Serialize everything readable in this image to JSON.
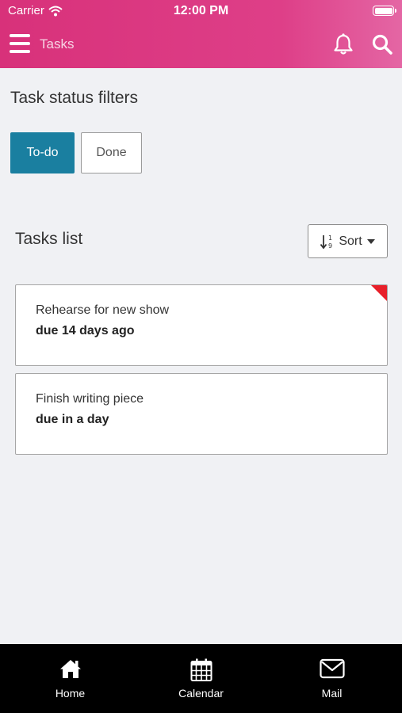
{
  "status_bar": {
    "carrier": "Carrier",
    "time": "12:00 PM"
  },
  "nav": {
    "title": "Tasks"
  },
  "filters": {
    "title": "Task status filters",
    "options": [
      {
        "label": "To-do",
        "selected": true
      },
      {
        "label": "Done",
        "selected": false
      }
    ]
  },
  "tasks": {
    "title": "Tasks list",
    "sort_label": "Sort",
    "items": [
      {
        "name": "Rehearse for new show",
        "due": "due 14 days ago",
        "overdue": true
      },
      {
        "name": "Finish writing piece",
        "due": "due in a day",
        "overdue": false
      }
    ]
  },
  "tabbar": {
    "items": [
      {
        "label": "Home",
        "icon": "home-icon"
      },
      {
        "label": "Calendar",
        "icon": "calendar-icon"
      },
      {
        "label": "Mail",
        "icon": "mail-icon"
      }
    ]
  },
  "colors": {
    "header": "#d8317a",
    "active_filter": "#1a7fa0",
    "overdue": "#e8202a",
    "tabbar": "#000000"
  }
}
